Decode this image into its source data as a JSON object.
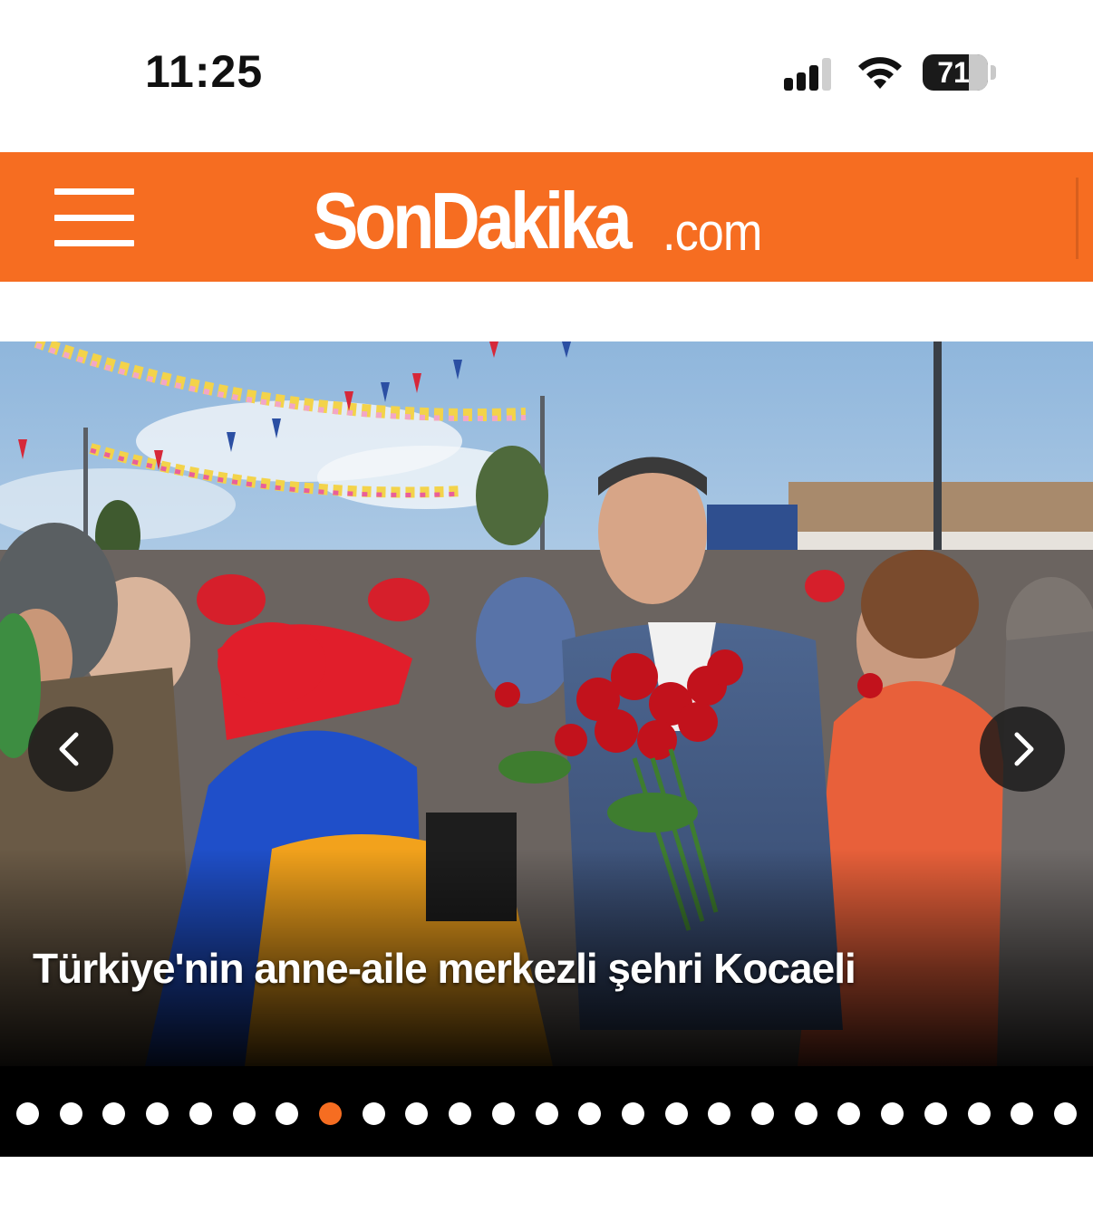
{
  "status_bar": {
    "time": "11:25",
    "battery_percent": "71",
    "signal_bars": 3,
    "icons": [
      "cellular-signal-icon",
      "wifi-icon",
      "battery-icon"
    ]
  },
  "header": {
    "background_color": "#f66d21",
    "logo_main": "SonDakika",
    "logo_suffix": ".com",
    "menu_icon": "hamburger-menu-icon"
  },
  "slider": {
    "headline": "Türkiye'nin anne-aile merkezli şehri Kocaeli",
    "prev_icon": "chevron-left-icon",
    "next_icon": "chevron-right-icon",
    "slide_count": 25,
    "active_index": 7,
    "active_color": "#f66d21"
  }
}
